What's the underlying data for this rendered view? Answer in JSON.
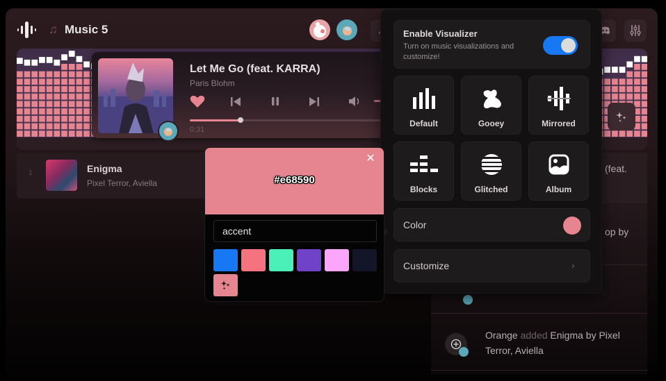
{
  "header": {
    "title": "Music 5",
    "logo_icon": "sound-wave-icon",
    "note_icon": "music-note-icon",
    "avatars": [
      "user-avatar-bunny",
      "user-avatar-crewmate"
    ],
    "buttons": [
      "share-icon",
      "discord-icon",
      "equalizer-settings-icon"
    ]
  },
  "now_playing": {
    "title": "Let Me Go (feat. KARRA)",
    "artist": "Paris Blohm",
    "elapsed": "0:31",
    "progress_fraction": 0.25,
    "volume_fraction": 0.9,
    "liked": true,
    "controls": [
      "heart-icon",
      "previous-icon",
      "pause-icon",
      "next-icon",
      "volume-icon"
    ]
  },
  "visualizer": {
    "accent": "#e68590",
    "peak_color": "#ffffff",
    "levels": [
      0.82,
      0.8,
      0.8,
      0.83,
      0.83,
      0.8,
      0.86,
      0.9,
      0.84,
      0.78,
      0.76,
      0.7,
      0.7,
      0.7,
      0.7,
      0.7,
      0.7,
      0.7,
      0.7,
      0.7,
      0.7,
      0.7,
      0.7,
      0.7,
      0.7,
      0.7,
      0.7,
      0.7,
      0.7,
      0.7,
      0.7,
      0.7,
      0.7,
      0.7,
      0.7,
      0.7,
      0.7,
      0.7,
      0.7,
      0.7,
      0.7,
      0.7,
      0.7,
      0.7,
      0.7,
      0.7,
      0.7,
      0.7,
      0.7,
      0.7,
      0.7,
      0.7,
      0.7,
      0.7,
      0.7,
      0.7,
      0.7,
      0.7,
      0.7,
      0.7,
      0.7,
      0.7,
      0.7,
      0.7,
      0.7,
      0.7,
      0.7,
      0.7,
      0.7,
      0.7,
      0.7,
      0.7,
      0.7,
      0.7,
      0.7,
      0.7,
      0.7,
      0.7,
      0.7,
      0.72,
      0.72,
      0.72,
      0.78,
      0.84,
      0.84
    ]
  },
  "queue": [
    {
      "index": "1",
      "title": "Enigma",
      "artist": "Pixel Terror, Aviella"
    }
  ],
  "activity": [
    {
      "text_visible": "(feat."
    },
    {
      "text_visible": "op by"
    },
    {
      "user": "Orange",
      "verb": "added",
      "song": "Enigma by Pixel Terror, Aviella"
    }
  ],
  "visualizer_panel": {
    "enable_title": "Enable Visualizer",
    "enable_subtitle": "Turn on music visualizations and customize!",
    "enabled": true,
    "modes": [
      {
        "label": "Default",
        "icon": "bars-icon"
      },
      {
        "label": "Gooey",
        "icon": "blob-icon"
      },
      {
        "label": "Mirrored",
        "icon": "mirrored-bars-icon"
      },
      {
        "label": "Blocks",
        "icon": "blocks-icon"
      },
      {
        "label": "Glitched",
        "icon": "glitched-circle-icon"
      },
      {
        "label": "Album",
        "icon": "image-icon"
      }
    ],
    "color_label": "Color",
    "color_value": "#e68590",
    "customize_label": "Customize"
  },
  "color_picker": {
    "hex": "#e68590",
    "input_value": "accent",
    "presets": [
      "#1877f2",
      "#f5737f",
      "#4befb8",
      "#7042c9",
      "#fca5fc",
      "#131628"
    ],
    "magic_color": "#e68590"
  }
}
